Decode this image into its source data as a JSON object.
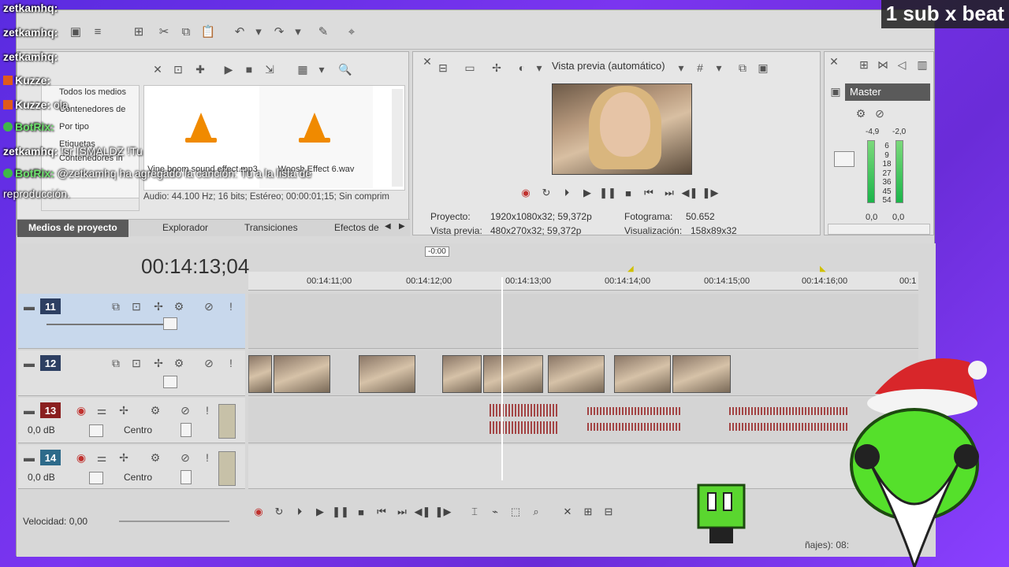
{
  "overlay": {
    "sub_banner": "1 sub x beat",
    "chat": [
      {
        "user": "zetkamhq:",
        "message": "",
        "kind": "plain"
      },
      {
        "user": "zetkamhq:",
        "message": "",
        "kind": "plain"
      },
      {
        "user": "zetkamhq:",
        "message": "",
        "kind": "plain"
      },
      {
        "user": "Kuzze:",
        "message": "",
        "kind": "badge"
      },
      {
        "user": "Kuzze:",
        "message": "ola",
        "kind": "badge"
      },
      {
        "user": "BotRix:",
        "message": "",
        "kind": "bot"
      },
      {
        "user": "zetkamhq:",
        "message": "!sr ISMALDZ !Tu",
        "kind": "plain"
      },
      {
        "user": "BotRix:",
        "message": "@zetkamhq ha agregado la canción: Tu a la lista de",
        "kind": "bot"
      },
      {
        "user": "",
        "message": "reproducción.",
        "kind": "plain"
      }
    ]
  },
  "media_panel": {
    "tree": [
      "Todos los medios",
      "Contenedores de",
      "Por tipo",
      "Etiquetas",
      "Contenedores in"
    ],
    "files": [
      {
        "name": "Vine boom sound effect.mp3",
        "icon": "vlc-cone-icon"
      },
      {
        "name": "Woosh Effect 6.wav",
        "icon": "vlc-cone-icon"
      }
    ],
    "info": "Audio: 44.100 Hz; 16 bits; Estéreo; 00:00:01;15; Sin comprim",
    "tabs": [
      "Medios de proyecto",
      "Explorador",
      "Transiciones",
      "Efectos de"
    ],
    "active_tab": "Medios de proyecto"
  },
  "preview": {
    "mode": "Vista previa (automático)",
    "stats": {
      "proyecto_label": "Proyecto:",
      "proyecto_value": "1920x1080x32; 59,372p",
      "vista_label": "Vista previa:",
      "vista_value": "480x270x32; 59,372p",
      "fotograma_label": "Fotograma:",
      "fotograma_value": "50.652",
      "visualizacion_label": "Visualización:",
      "visualizacion_value": "158x89x32"
    }
  },
  "master": {
    "label": "Master",
    "peak_left": "-4,9",
    "peak_right": "-2,0",
    "scale": [
      "6",
      "9",
      "18",
      "27",
      "36",
      "45",
      "54"
    ],
    "level_left": "0,0",
    "level_right": "0,0"
  },
  "timeline": {
    "timecode": "00:14:13;04",
    "offset": "-0:00",
    "ruler": [
      "00:14:11;00",
      "00:14:12;00",
      "00:14:13;00",
      "00:14:14;00",
      "00:14:15;00",
      "00:14:16;00",
      "00:1"
    ],
    "tracks": [
      {
        "num": "11",
        "type": "video"
      },
      {
        "num": "12",
        "type": "video"
      },
      {
        "num": "13",
        "type": "audio",
        "volume": "0,0 dB",
        "pan": "Centro"
      },
      {
        "num": "14",
        "type": "audio",
        "volume": "0,0 dB",
        "pan": "Centro"
      }
    ],
    "speed": "Velocidad: 0,00",
    "bottom_partial": "ñajes): 08:"
  },
  "colors": {
    "background": "#6a2cd8",
    "app_bg": "#d9d9d9",
    "bot_name": "#6fe36f",
    "video_track": "#2d3f62",
    "audio_track": "#8a1f1f",
    "record": "#c0312e"
  }
}
